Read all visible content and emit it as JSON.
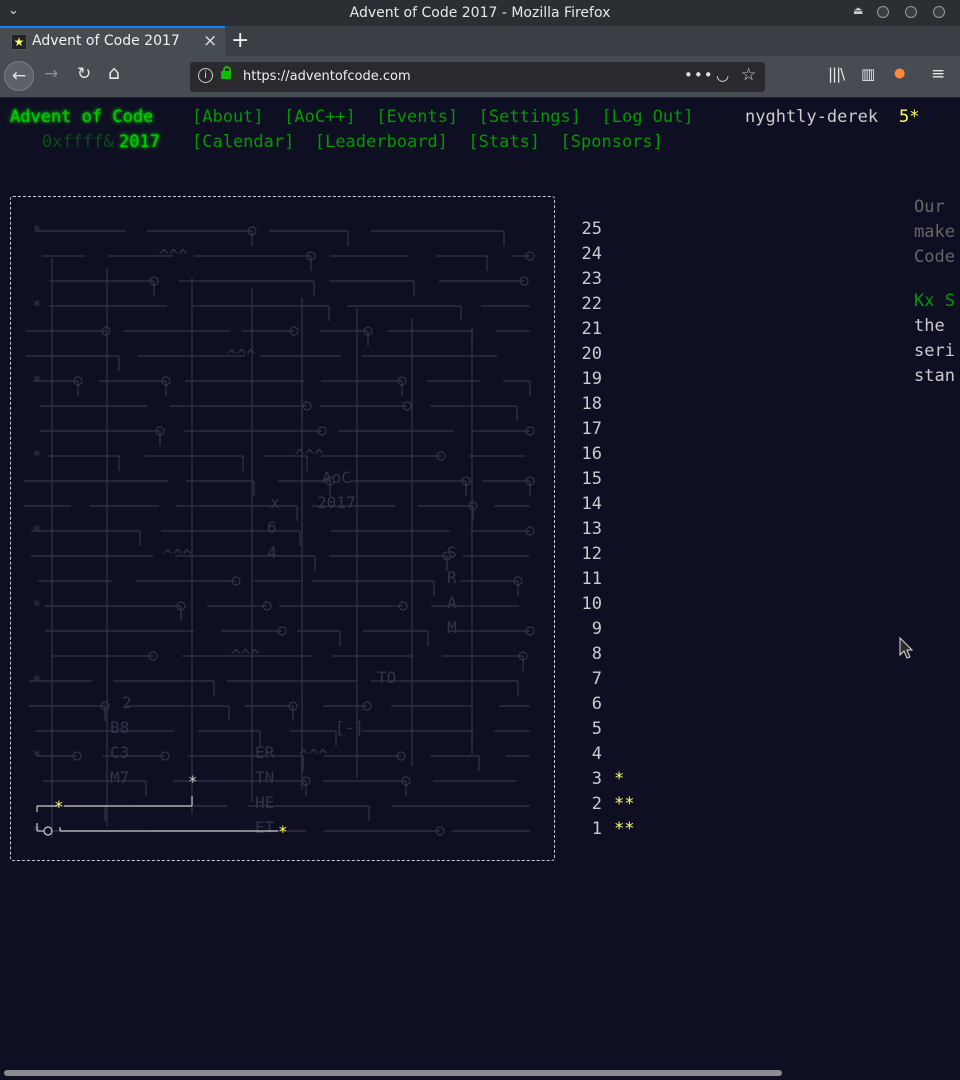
{
  "window": {
    "title": "Advent of Code 2017 - Mozilla Firefox"
  },
  "tab": {
    "label": "Advent of Code 2017"
  },
  "toolbar": {
    "url": "https://adventofcode.com",
    "more": "•••"
  },
  "header": {
    "title": "Advent of Code",
    "nav_top": [
      "[About]",
      "[AoC++]",
      "[Events]",
      "[Settings]",
      "[Log Out]"
    ],
    "user": "nyghtly-derek",
    "star_count": "5*",
    "subtitle": "0xffff&",
    "year": "2017",
    "nav_bottom": [
      "[Calendar]",
      "[Leaderboard]",
      "[Stats]",
      "[Sponsors]"
    ]
  },
  "calendar": {
    "days": [
      {
        "day": "25",
        "stars": ""
      },
      {
        "day": "24",
        "stars": ""
      },
      {
        "day": "23",
        "stars": ""
      },
      {
        "day": "22",
        "stars": ""
      },
      {
        "day": "21",
        "stars": ""
      },
      {
        "day": "20",
        "stars": ""
      },
      {
        "day": "19",
        "stars": ""
      },
      {
        "day": "18",
        "stars": ""
      },
      {
        "day": "17",
        "stars": ""
      },
      {
        "day": "16",
        "stars": ""
      },
      {
        "day": "15",
        "stars": ""
      },
      {
        "day": "14",
        "stars": ""
      },
      {
        "day": "13",
        "stars": ""
      },
      {
        "day": "12",
        "stars": ""
      },
      {
        "day": "11",
        "stars": ""
      },
      {
        "day": "10",
        "stars": ""
      },
      {
        "day": "9",
        "stars": ""
      },
      {
        "day": "8",
        "stars": ""
      },
      {
        "day": "7",
        "stars": ""
      },
      {
        "day": "6",
        "stars": ""
      },
      {
        "day": "5",
        "stars": ""
      },
      {
        "day": "4",
        "stars": ""
      },
      {
        "day": "3",
        "stars": "*"
      },
      {
        "day": "2",
        "stars": "**"
      },
      {
        "day": "1",
        "stars": "**"
      }
    ],
    "circuit_labels": [
      "AoC",
      "2017",
      "x",
      "6",
      "4",
      "S",
      "R",
      "A",
      "M",
      "2",
      "B8",
      "C3",
      "M7",
      "ER",
      "TN",
      "HE",
      "ET",
      "[-]",
      "TO"
    ]
  },
  "sidebar": {
    "lines": [
      "Our",
      "make",
      "Code"
    ],
    "sponsor": "Kx S",
    "sponsor_lines": [
      "the",
      "seri",
      "stan"
    ]
  },
  "colors": {
    "background": "#0f0f23",
    "green": "#00cc00",
    "link": "#009900",
    "star": "#ffff66",
    "text": "#cccccc"
  }
}
